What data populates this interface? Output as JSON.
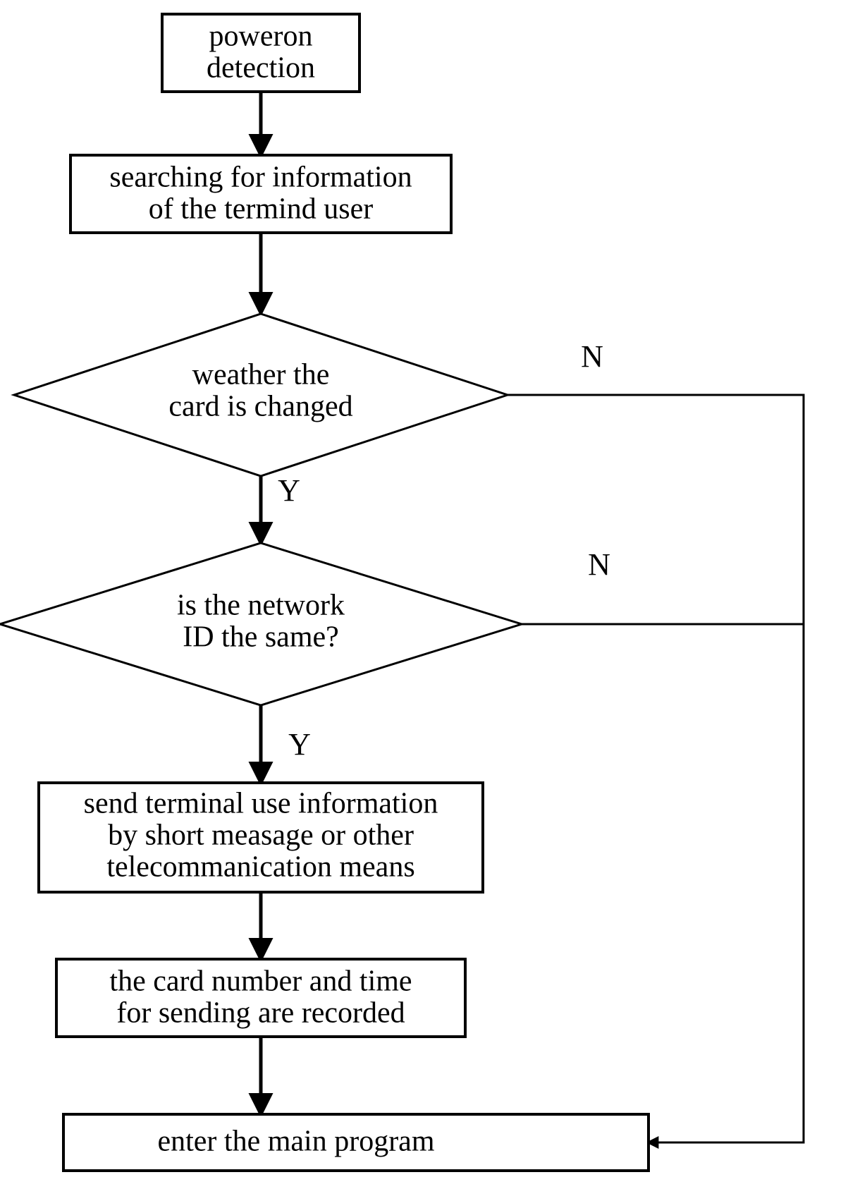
{
  "nodes": {
    "n1": {
      "l1": "poweron",
      "l2": "detection"
    },
    "n2": {
      "l1": "searching for information",
      "l2": "of the termind user"
    },
    "n3": {
      "l1": "weather the",
      "l2": "card is changed"
    },
    "n4": {
      "l1": "is the network",
      "l2": "ID the same?"
    },
    "n5": {
      "l1": "send terminal use information",
      "l2": "by short measage or other",
      "l3": "telecommanication means"
    },
    "n6": {
      "l1": "the card number and time",
      "l2": "for sending are recorded"
    },
    "n7": {
      "l1": "enter the main program"
    }
  },
  "branches": {
    "y": "Y",
    "n": "N"
  }
}
